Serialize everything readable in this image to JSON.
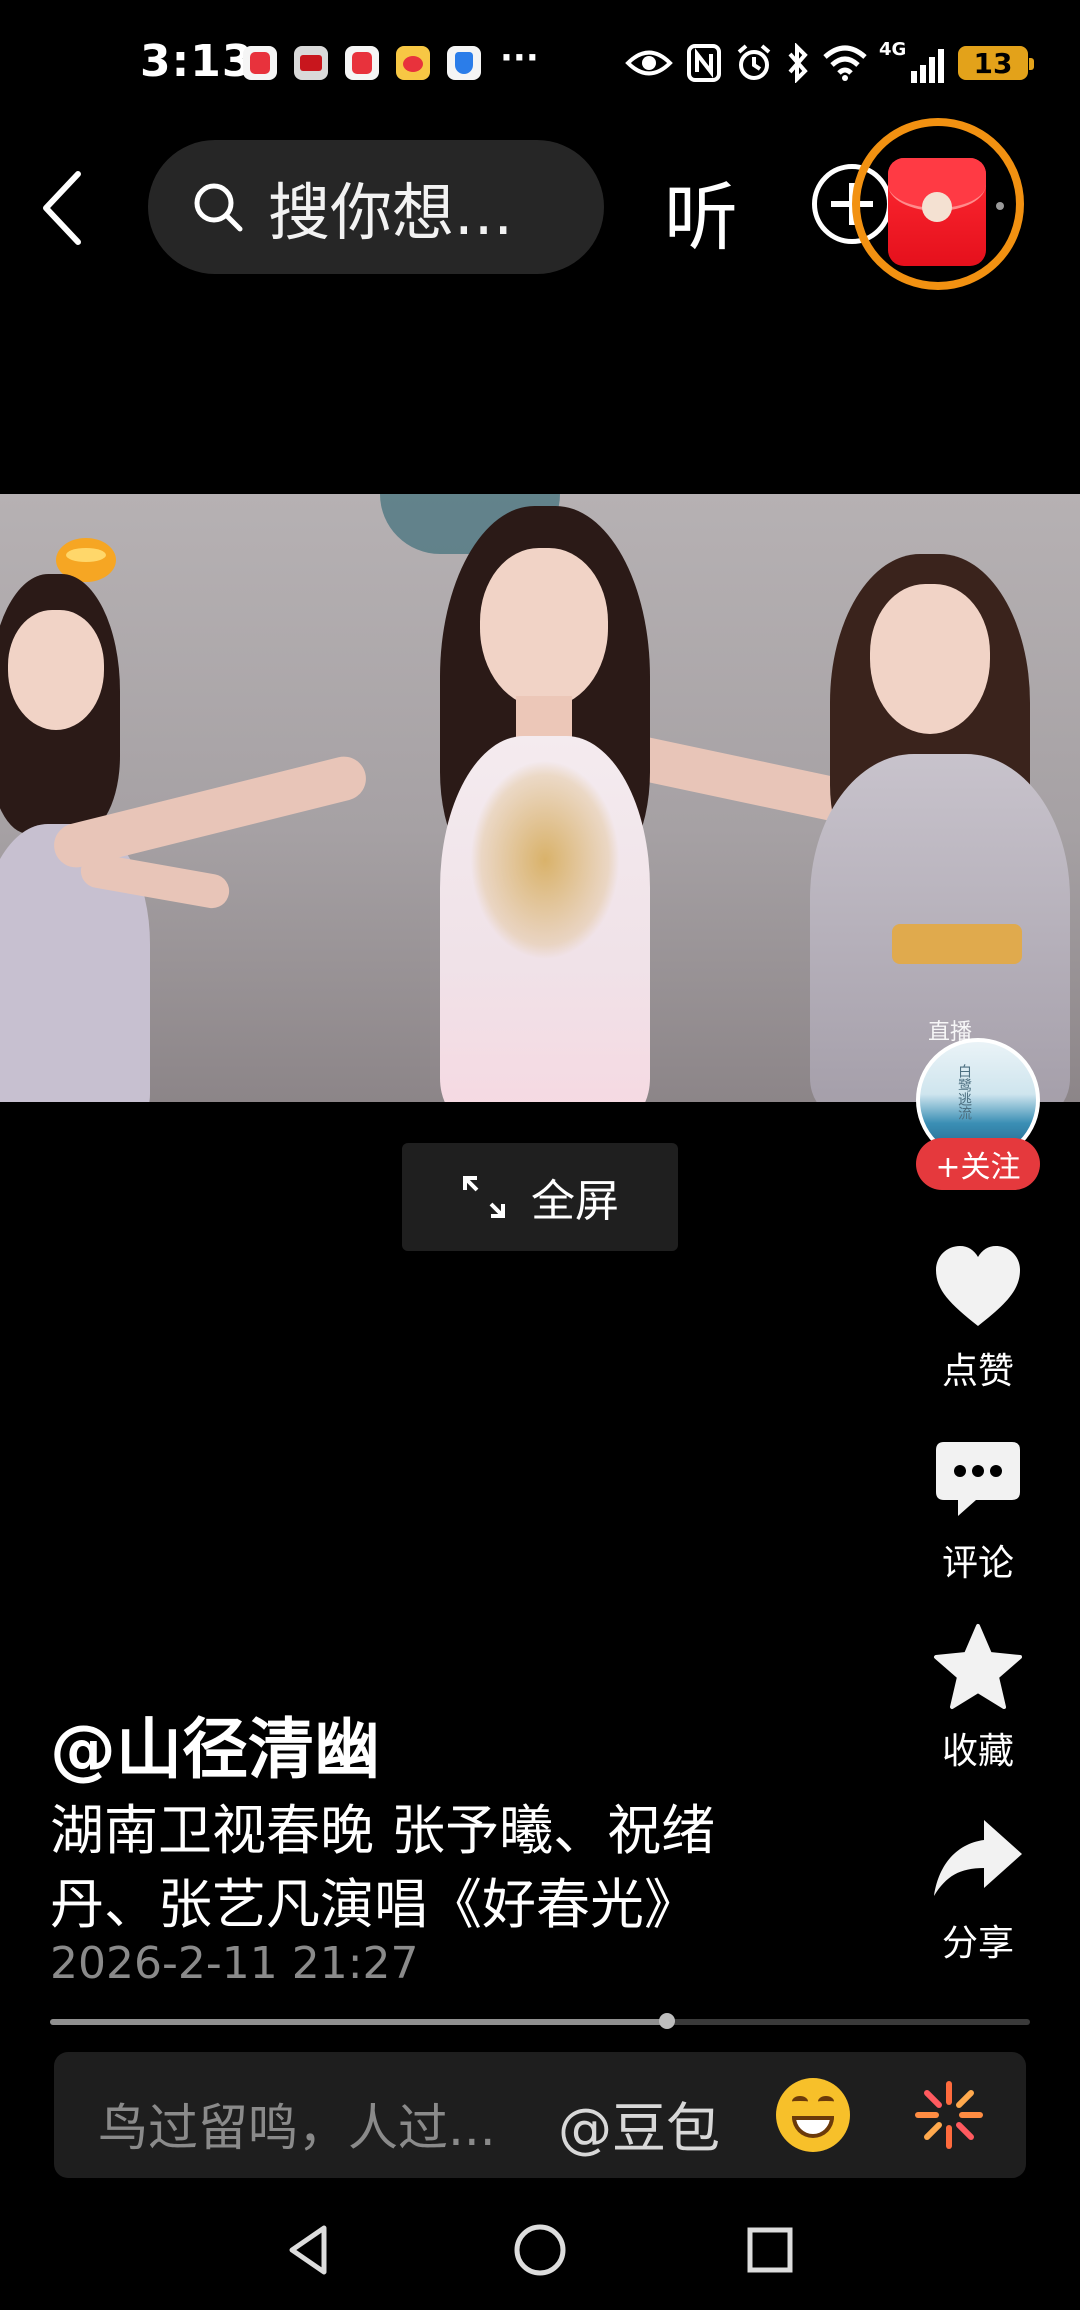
{
  "status_bar": {
    "time": "3:13",
    "network": "4G",
    "battery": "13",
    "more": "···"
  },
  "top_nav": {
    "search_placeholder": "搜你想...",
    "listen_label": "听"
  },
  "video": {
    "live_watermark": "直播"
  },
  "controls": {
    "fullscreen_label": "全屏"
  },
  "right_rail": {
    "avatar_text": "白鹭逃流",
    "follow_label": "+关注",
    "like_label": "点赞",
    "comment_label": "评论",
    "favorite_label": "收藏",
    "share_label": "分享"
  },
  "post": {
    "author": "@山径清幽",
    "caption": "湖南卫视春晚 张予曦、祝绪丹、张艺凡演唱《好春光》",
    "timestamp": "2026-2-11 21:27",
    "progress": 0.63
  },
  "comment_bar": {
    "placeholder": "鸟过留鸣，人过...",
    "mention_label": "@豆包"
  },
  "colors": {
    "follow": "#e5393d",
    "redpacket": "#ff2a33",
    "redpacket_ring": "#f29111",
    "battery": "#e3a21a"
  }
}
